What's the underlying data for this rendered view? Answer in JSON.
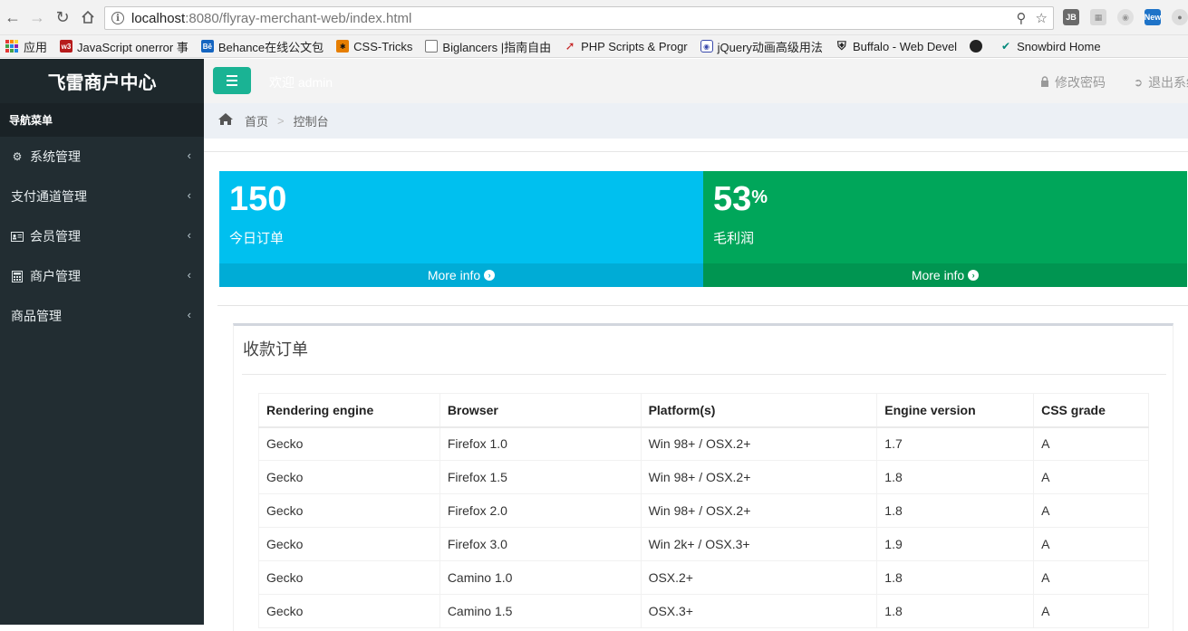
{
  "browser": {
    "url_host": "localhost",
    "url_rest": ":8080/flyray-merchant-web/index.html",
    "bookmarks": [
      {
        "label": "应用",
        "icon": "apps-grid-icon"
      },
      {
        "label": "JavaScript onerror 事",
        "icon": "w3-icon"
      },
      {
        "label": "Behance在线公文包",
        "icon": "behance-icon"
      },
      {
        "label": "CSS-Tricks",
        "icon": "css-tricks-icon"
      },
      {
        "label": "Biglancers |指南自由",
        "icon": "page-icon"
      },
      {
        "label": "PHP Scripts & Progr",
        "icon": "php-icon"
      },
      {
        "label": "jQuery动画高级用法",
        "icon": "jquery-icon"
      },
      {
        "label": "Buffalo - Web Devel",
        "icon": "shield-icon"
      },
      {
        "label": "",
        "icon": "github-icon"
      },
      {
        "label": "Snowbird Home",
        "icon": "snowbird-icon"
      }
    ]
  },
  "sidebar": {
    "logo": "飞雷商户中心",
    "header": "导航菜单",
    "items": [
      {
        "label": "系统管理",
        "icon": "gear-icon"
      },
      {
        "label": "支付通道管理",
        "icon": ""
      },
      {
        "label": "会员管理",
        "icon": "id-card-icon"
      },
      {
        "label": "商户管理",
        "icon": "calculator-icon"
      },
      {
        "label": "商品管理",
        "icon": ""
      }
    ]
  },
  "header": {
    "welcome": "欢迎 admin",
    "change_password": "修改密码",
    "logout": "退出系统"
  },
  "breadcrumb": {
    "home": "首页",
    "separator": ">",
    "current": "控制台"
  },
  "stats": [
    {
      "value": "150",
      "suffix": "",
      "label": "今日订单",
      "more": "More info",
      "color": "#00c0ef",
      "footer_color": "#00acd6"
    },
    {
      "value": "53",
      "suffix": "%",
      "label": "毛利润",
      "more": "More info",
      "color": "#00a65a",
      "footer_color": "#009551"
    }
  ],
  "orders": {
    "title": "收款订单",
    "columns": [
      "Rendering engine",
      "Browser",
      "Platform(s)",
      "Engine version",
      "CSS grade"
    ],
    "rows": [
      [
        "Gecko",
        "Firefox 1.0",
        "Win 98+ / OSX.2+",
        "1.7",
        "A"
      ],
      [
        "Gecko",
        "Firefox 1.5",
        "Win 98+ / OSX.2+",
        "1.8",
        "A"
      ],
      [
        "Gecko",
        "Firefox 2.0",
        "Win 98+ / OSX.2+",
        "1.8",
        "A"
      ],
      [
        "Gecko",
        "Firefox 3.0",
        "Win 2k+ / OSX.3+",
        "1.9",
        "A"
      ],
      [
        "Gecko",
        "Camino 1.0",
        "OSX.2+",
        "1.8",
        "A"
      ],
      [
        "Gecko",
        "Camino 1.5",
        "OSX.3+",
        "1.8",
        "A"
      ]
    ]
  }
}
